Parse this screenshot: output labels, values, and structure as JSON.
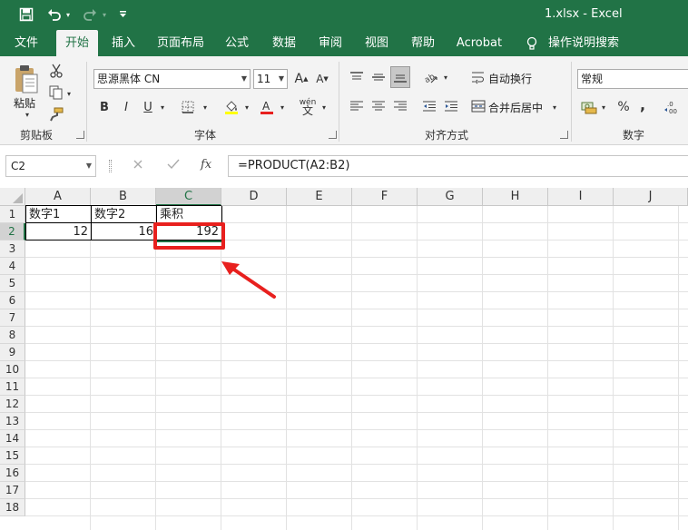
{
  "titlebar": {
    "title": "1.xlsx  -  Excel",
    "save_icon": "save-icon",
    "undo_icon": "undo-icon",
    "redo_icon": "redo-icon",
    "customize_icon": "customize-qat-icon"
  },
  "tabs": [
    "文件",
    "开始",
    "插入",
    "页面布局",
    "公式",
    "数据",
    "审阅",
    "视图",
    "帮助",
    "Acrobat",
    "操作说明搜索"
  ],
  "ribbon": {
    "clipboard": {
      "paste_label": "粘贴",
      "group_label": "剪贴板"
    },
    "font": {
      "name": "思源黑体 CN",
      "size": "11",
      "bold": "B",
      "italic": "I",
      "underline": "U",
      "group_label": "字体",
      "grow": "A",
      "shrink": "A",
      "phonetic": "wén"
    },
    "alignment": {
      "wrap_label": "自动换行",
      "merge_label": "合并后居中",
      "group_label": "对齐方式"
    },
    "number": {
      "format": "常规",
      "percent": "%",
      "comma": ",",
      "group_label": "数字"
    }
  },
  "formula_bar": {
    "name_box": "C2",
    "formula": "=PRODUCT(A2:B2)",
    "fx_label": "fx"
  },
  "columns": [
    "A",
    "B",
    "C",
    "D",
    "E",
    "F",
    "G",
    "H",
    "I",
    "J"
  ],
  "rows": [
    "1",
    "2",
    "3",
    "4",
    "5",
    "6",
    "7",
    "8",
    "9",
    "10",
    "11",
    "12",
    "13",
    "14",
    "15",
    "16",
    "17",
    "18"
  ],
  "cells": {
    "A1": "数字1",
    "B1": "数字2",
    "C1": "乘积",
    "A2": "12",
    "B2": "16",
    "C2": "192"
  },
  "colors": {
    "accent": "#217346",
    "highlight": "#e8201e"
  }
}
